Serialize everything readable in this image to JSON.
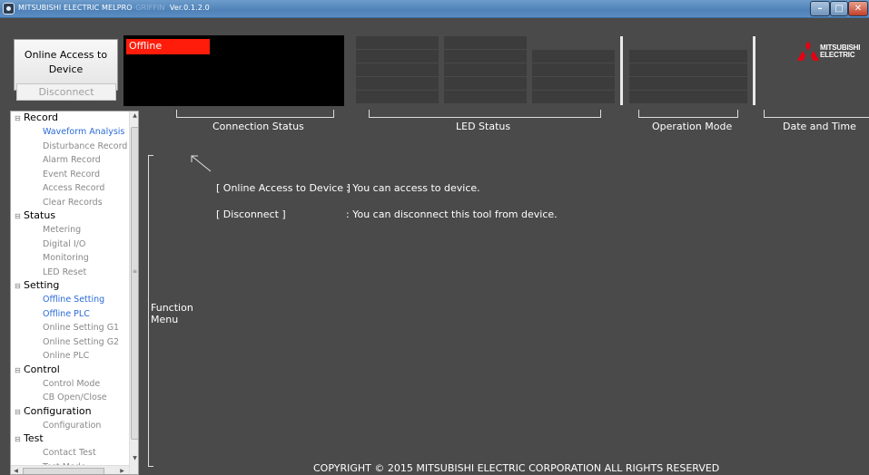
{
  "window": {
    "title_prefix": "MITSUBISHI ELECTRIC  MELPRO",
    "title_faint": "-GRIFFIN",
    "title_version": "Ver.0.1.2.0"
  },
  "header": {
    "online_button_label": "Online Access to Device",
    "disconnect_button_label": "Disconnect",
    "connection_state": "Offline",
    "logo_text_line1": "MITSUBISHI",
    "logo_text_line2": "ELECTRIC"
  },
  "sections": {
    "connection_status": "Connection Status",
    "led_status": "LED Status",
    "operation_mode": "Operation Mode",
    "date_and_time": "Date and Time"
  },
  "sidebar": {
    "categories": [
      {
        "label": "Record",
        "items": [
          {
            "label": "Waveform Analysis",
            "active": true
          },
          {
            "label": "Disturbance Record",
            "active": false
          },
          {
            "label": "Alarm Record",
            "active": false
          },
          {
            "label": "Event Record",
            "active": false
          },
          {
            "label": "Access Record",
            "active": false
          },
          {
            "label": "Clear Records",
            "active": false
          }
        ]
      },
      {
        "label": "Status",
        "items": [
          {
            "label": "Metering",
            "active": false
          },
          {
            "label": "Digital I/O",
            "active": false
          },
          {
            "label": "Monitoring",
            "active": false
          },
          {
            "label": "LED Reset",
            "active": false
          }
        ]
      },
      {
        "label": "Setting",
        "items": [
          {
            "label": "Offline Setting",
            "active": true
          },
          {
            "label": "Offline PLC",
            "active": true
          },
          {
            "label": "Online Setting G1",
            "active": false
          },
          {
            "label": "Online Setting G2",
            "active": false
          },
          {
            "label": "Online PLC",
            "active": false
          }
        ]
      },
      {
        "label": "Control",
        "items": [
          {
            "label": "Control Mode",
            "active": false
          },
          {
            "label": "CB Open/Close",
            "active": false
          }
        ]
      },
      {
        "label": "Configuration",
        "items": [
          {
            "label": "Configuration",
            "active": false
          }
        ]
      },
      {
        "label": "Test",
        "items": [
          {
            "label": "Contact Test",
            "active": false
          },
          {
            "label": "Test Mode",
            "active": false
          }
        ]
      }
    ]
  },
  "main": {
    "function_menu_line1": "Function",
    "function_menu_line2": "Menu",
    "info": [
      {
        "key": "[ Online Access to Device ]",
        "desc": ": You can access to device."
      },
      {
        "key": "[ Disconnect ]",
        "desc": ": You can disconnect this tool from device."
      }
    ],
    "copyright": "COPYRIGHT © 2015 MITSUBISHI ELECTRIC CORPORATION ALL RIGHTS RESERVED"
  },
  "colors": {
    "offline_chip": "#ff1c0a",
    "active_item": "#2a6ad8",
    "background": "#4a4a4a",
    "logo_red": "#e60012"
  }
}
